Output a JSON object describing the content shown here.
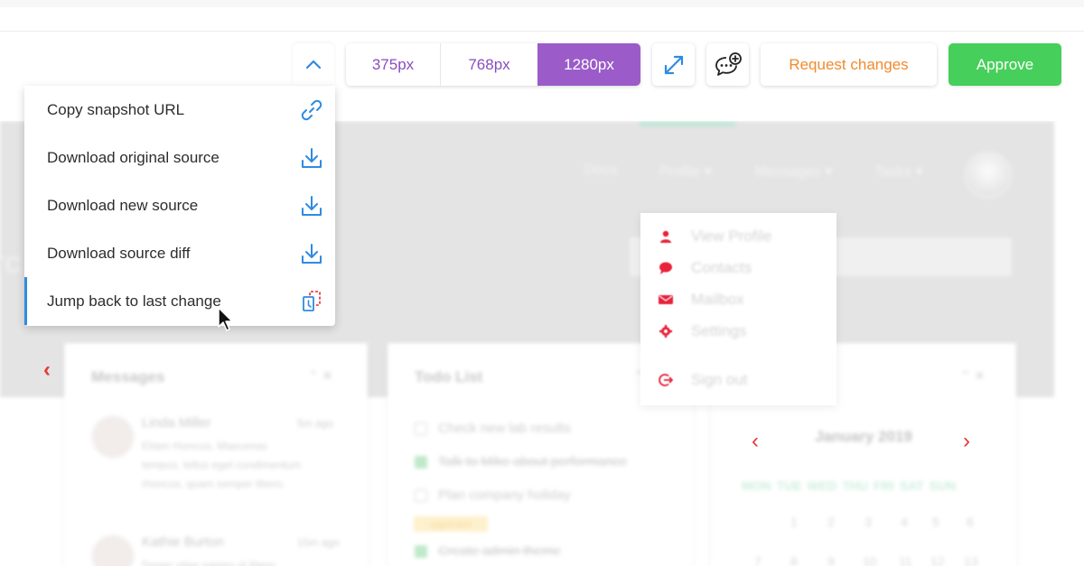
{
  "toolbar": {
    "viewports": [
      "375px",
      "768px",
      "1280px"
    ],
    "selected_viewport": "1280px",
    "request_changes_label": "Request changes",
    "approve_label": "Approve",
    "accent_color": "#9b5cc9",
    "approve_color": "#46cf5a",
    "request_color": "#f28a2e"
  },
  "snapshot_menu": {
    "items": [
      {
        "label": "Copy snapshot URL",
        "icon": "link-icon"
      },
      {
        "label": "Download original source",
        "icon": "download-icon"
      },
      {
        "label": "Download new source",
        "icon": "download-icon"
      },
      {
        "label": "Download source diff",
        "icon": "download-icon"
      },
      {
        "label": "Jump back to last change",
        "icon": "jump-back-icon"
      }
    ],
    "active_item": "Jump back to last change"
  },
  "preview": {
    "hero_letters": "rc",
    "nav": [
      "Docs",
      "Profile ▾",
      "Messages ▾",
      "Tasks ▾"
    ],
    "profile_menu": [
      "View Profile",
      "Contacts",
      "Mailbox",
      "Settings",
      "Sign out"
    ],
    "messages_card": {
      "title": "Messages",
      "items": [
        {
          "name": "Linda Miller",
          "time": "5m ago",
          "text": "Etiam rhoncus. Maecenas tempus, tellus eget condimentum rhoncus, quam semper libero."
        },
        {
          "name": "Kathie Burton",
          "time": "15m ago",
          "text": "Donec vitae sapien ut libero venenatis faucibus. Duis"
        }
      ]
    },
    "todo_card": {
      "title": "Todo List",
      "items": [
        {
          "text": "Check new lab results",
          "done": false
        },
        {
          "text": "Talk to Mike about performance",
          "done": true
        },
        {
          "text": "Plan company holiday",
          "done": false
        },
        {
          "text": "Create admin theme",
          "done": true
        }
      ],
      "tag": "urgent item"
    },
    "calendar_card": {
      "month": "January 2019",
      "days": [
        "MON",
        "TUE",
        "WED",
        "THU",
        "FRI",
        "SAT",
        "SUN"
      ],
      "week1": [
        "1",
        "2",
        "3",
        "4",
        "5",
        "6"
      ],
      "week2": [
        "7",
        "8",
        "9",
        "10",
        "11",
        "12",
        "13"
      ]
    },
    "card_controls": "⌃ ✕"
  }
}
